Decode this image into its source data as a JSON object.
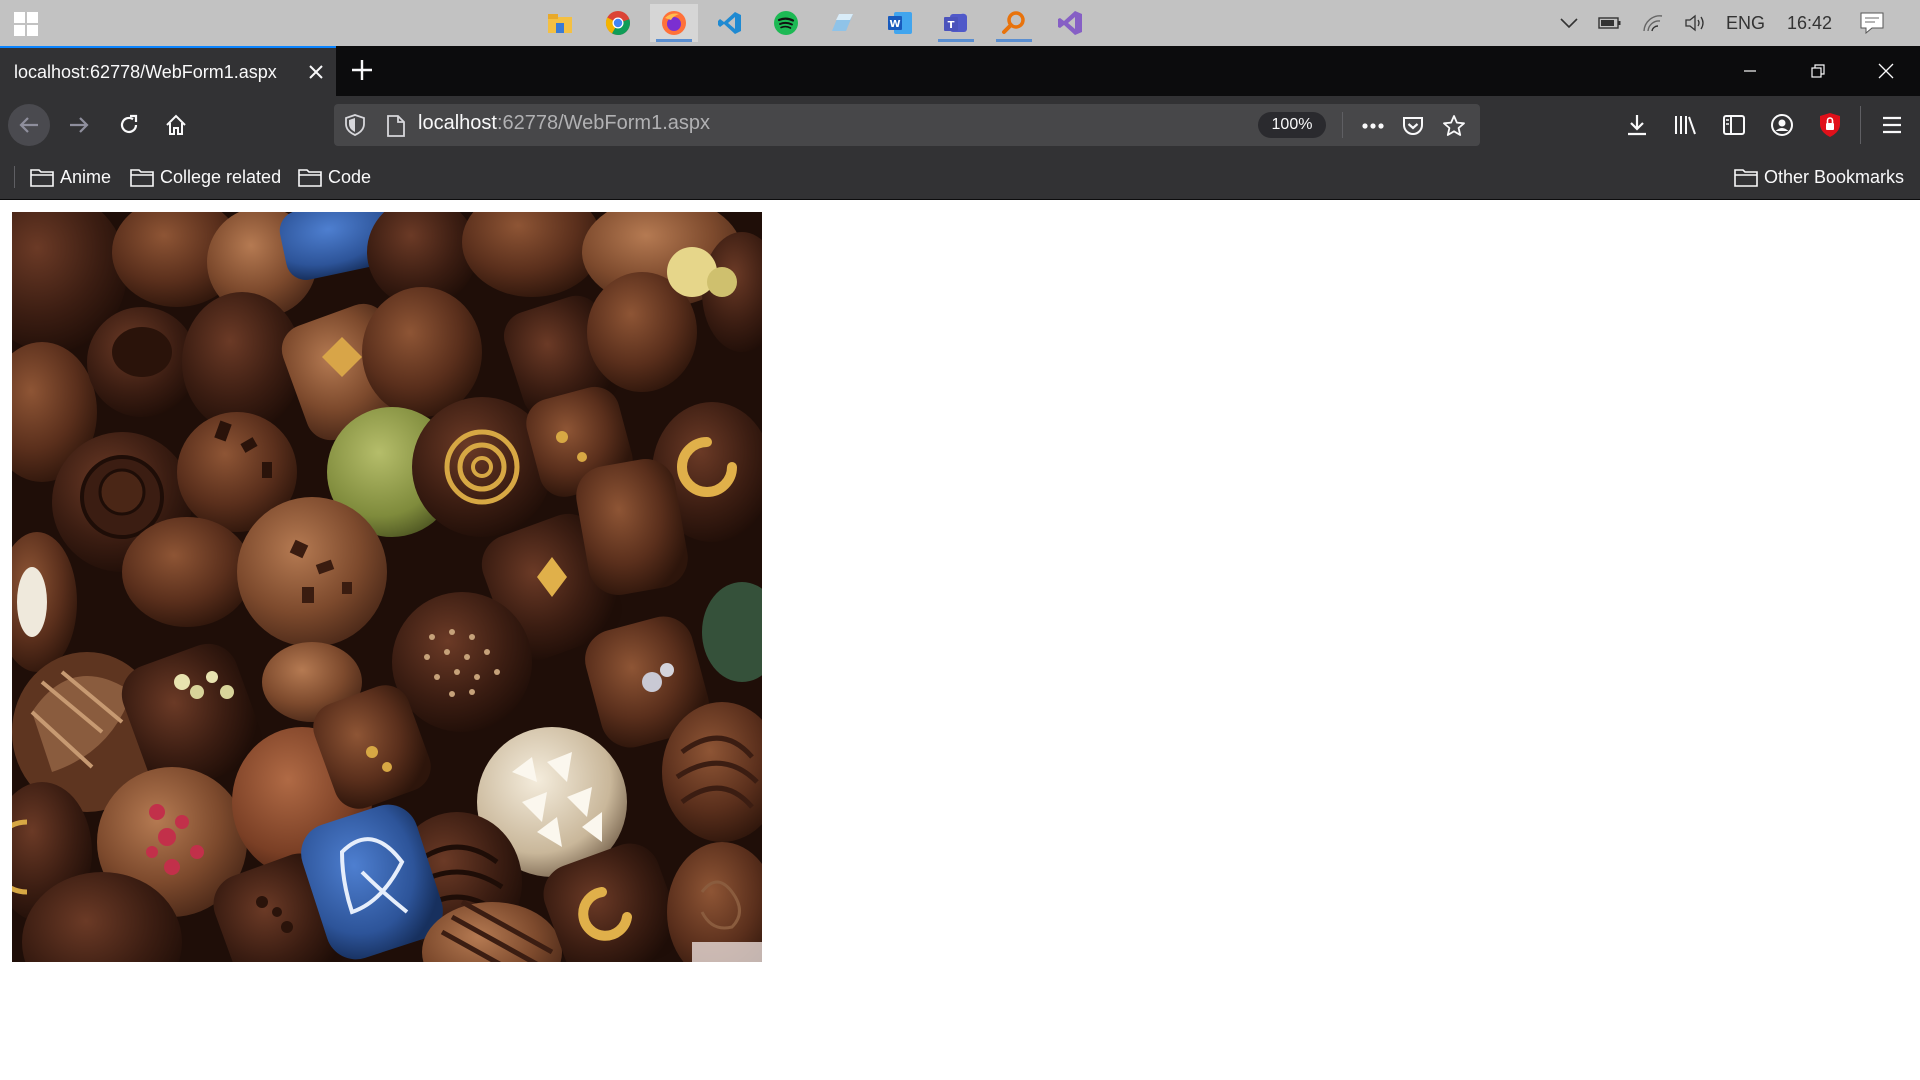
{
  "taskbar": {
    "apps": [
      {
        "name": "file-explorer-icon"
      },
      {
        "name": "chrome-icon"
      },
      {
        "name": "firefox-icon"
      },
      {
        "name": "vscode-icon"
      },
      {
        "name": "spotify-icon"
      },
      {
        "name": "generic-app-icon"
      },
      {
        "name": "word-icon"
      },
      {
        "name": "teams-icon"
      },
      {
        "name": "search-tool-icon"
      },
      {
        "name": "visual-studio-icon"
      }
    ],
    "tray": {
      "language": "ENG",
      "time": "16:42"
    }
  },
  "browser": {
    "tab_title": "localhost:62778/WebForm1.aspx",
    "url_host": "localhost",
    "url_rest": ":62778/WebForm1.aspx",
    "zoom": "100%",
    "bookmarks": [
      "Anime",
      "College related",
      "Code"
    ],
    "other_bookmarks": "Other Bookmarks"
  },
  "colors": {
    "accent": "#0a84ff",
    "toolbar": "#323234",
    "tabstrip": "#0c0c0d",
    "taskbar": "#c2c2c2"
  }
}
